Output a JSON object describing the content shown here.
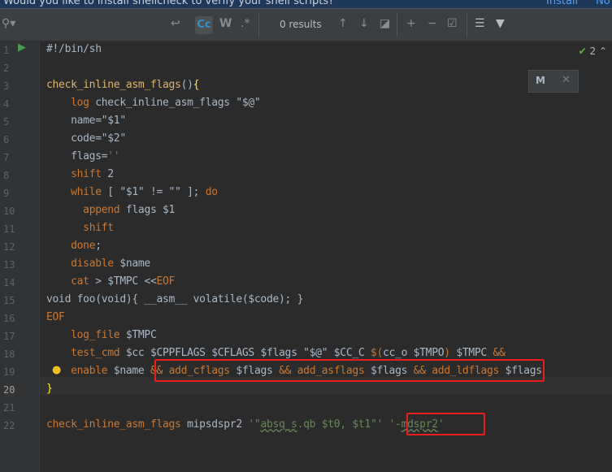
{
  "banner": {
    "message": "Would you like to install shellcheck to verify your shell scripts?",
    "install": "Install",
    "no": "No"
  },
  "find": {
    "results": "0 results",
    "match_case": "Cc",
    "words": "W",
    "regex": ".*"
  },
  "inspection": {
    "count": "2"
  },
  "colors": {
    "keyword": "#cc7832",
    "string": "#6a8759",
    "text": "#a9b7c6",
    "highlight_box": "#e8201c"
  },
  "lines": [
    [
      [
        "t",
        "#!/bin/sh"
      ]
    ],
    [],
    [
      [
        "f",
        "check_inline_asm_flags"
      ],
      [
        "t",
        "()"
      ],
      [
        "b",
        "{"
      ]
    ],
    [
      [
        "t",
        "    "
      ],
      [
        "k",
        "log"
      ],
      [
        "t",
        " check_inline_asm_flags \"$@\""
      ]
    ],
    [
      [
        "t",
        "    name=\"$1\""
      ]
    ],
    [
      [
        "t",
        "    code=\"$2\""
      ]
    ],
    [
      [
        "t",
        "    flags="
      ],
      [
        "s",
        "''"
      ]
    ],
    [
      [
        "t",
        "    "
      ],
      [
        "k",
        "shift"
      ],
      [
        "t",
        " 2"
      ]
    ],
    [
      [
        "t",
        "    "
      ],
      [
        "k",
        "while"
      ],
      [
        "t",
        " [ \"$1\" != \"\" ]; "
      ],
      [
        "k",
        "do"
      ]
    ],
    [
      [
        "t",
        "      "
      ],
      [
        "k",
        "append"
      ],
      [
        "t",
        " flags $1"
      ]
    ],
    [
      [
        "t",
        "      "
      ],
      [
        "k",
        "shift"
      ]
    ],
    [
      [
        "t",
        "    "
      ],
      [
        "k",
        "done"
      ],
      [
        "t",
        ";"
      ]
    ],
    [
      [
        "t",
        "    "
      ],
      [
        "k",
        "disable"
      ],
      [
        "t",
        " $name"
      ]
    ],
    [
      [
        "t",
        "    "
      ],
      [
        "k",
        "cat"
      ],
      [
        "t",
        " > $TMPC <<"
      ],
      [
        "k",
        "EOF"
      ]
    ],
    [
      [
        "t",
        "void foo(void){ __asm__ volatile($code); }"
      ]
    ],
    [
      [
        "k",
        "EOF"
      ]
    ],
    [
      [
        "t",
        "    "
      ],
      [
        "k",
        "log_file"
      ],
      [
        "t",
        " $TMPC"
      ]
    ],
    [
      [
        "t",
        "    "
      ],
      [
        "k",
        "test_cmd"
      ],
      [
        "t",
        " $cc $CPPFLAGS $CFLAGS $flags \"$@\" $CC_C "
      ],
      [
        "k",
        "$("
      ],
      [
        "t",
        "cc_o $TMPO"
      ],
      [
        "k",
        ")"
      ],
      [
        "t",
        " $TMPC "
      ],
      [
        "k",
        "&&"
      ]
    ],
    [
      [
        "t",
        "    "
      ],
      [
        "k",
        "enable"
      ],
      [
        "t",
        " $name "
      ],
      [
        "k",
        "&&"
      ],
      [
        "t",
        " "
      ],
      [
        "k",
        "add_cflags"
      ],
      [
        "t",
        " $flags "
      ],
      [
        "k",
        "&&"
      ],
      [
        "t",
        " "
      ],
      [
        "k",
        "add_asflags"
      ],
      [
        "t",
        " $flags "
      ],
      [
        "k",
        "&&"
      ],
      [
        "t",
        " "
      ],
      [
        "k",
        "add_ldflags"
      ],
      [
        "t",
        " $flags"
      ]
    ],
    [
      [
        "b",
        "}"
      ]
    ],
    [],
    [
      [
        "k",
        "check_inline_asm_flags"
      ],
      [
        "t",
        " mipsdspr2 "
      ],
      [
        "s",
        "'\""
      ],
      [
        "s w",
        "absq_s"
      ],
      [
        "s",
        ".qb $t0, $t1\"'"
      ],
      [
        "t",
        " "
      ],
      [
        "s",
        "'-"
      ],
      [
        "s w",
        "mdspr2"
      ],
      [
        "s",
        "'"
      ]
    ]
  ]
}
